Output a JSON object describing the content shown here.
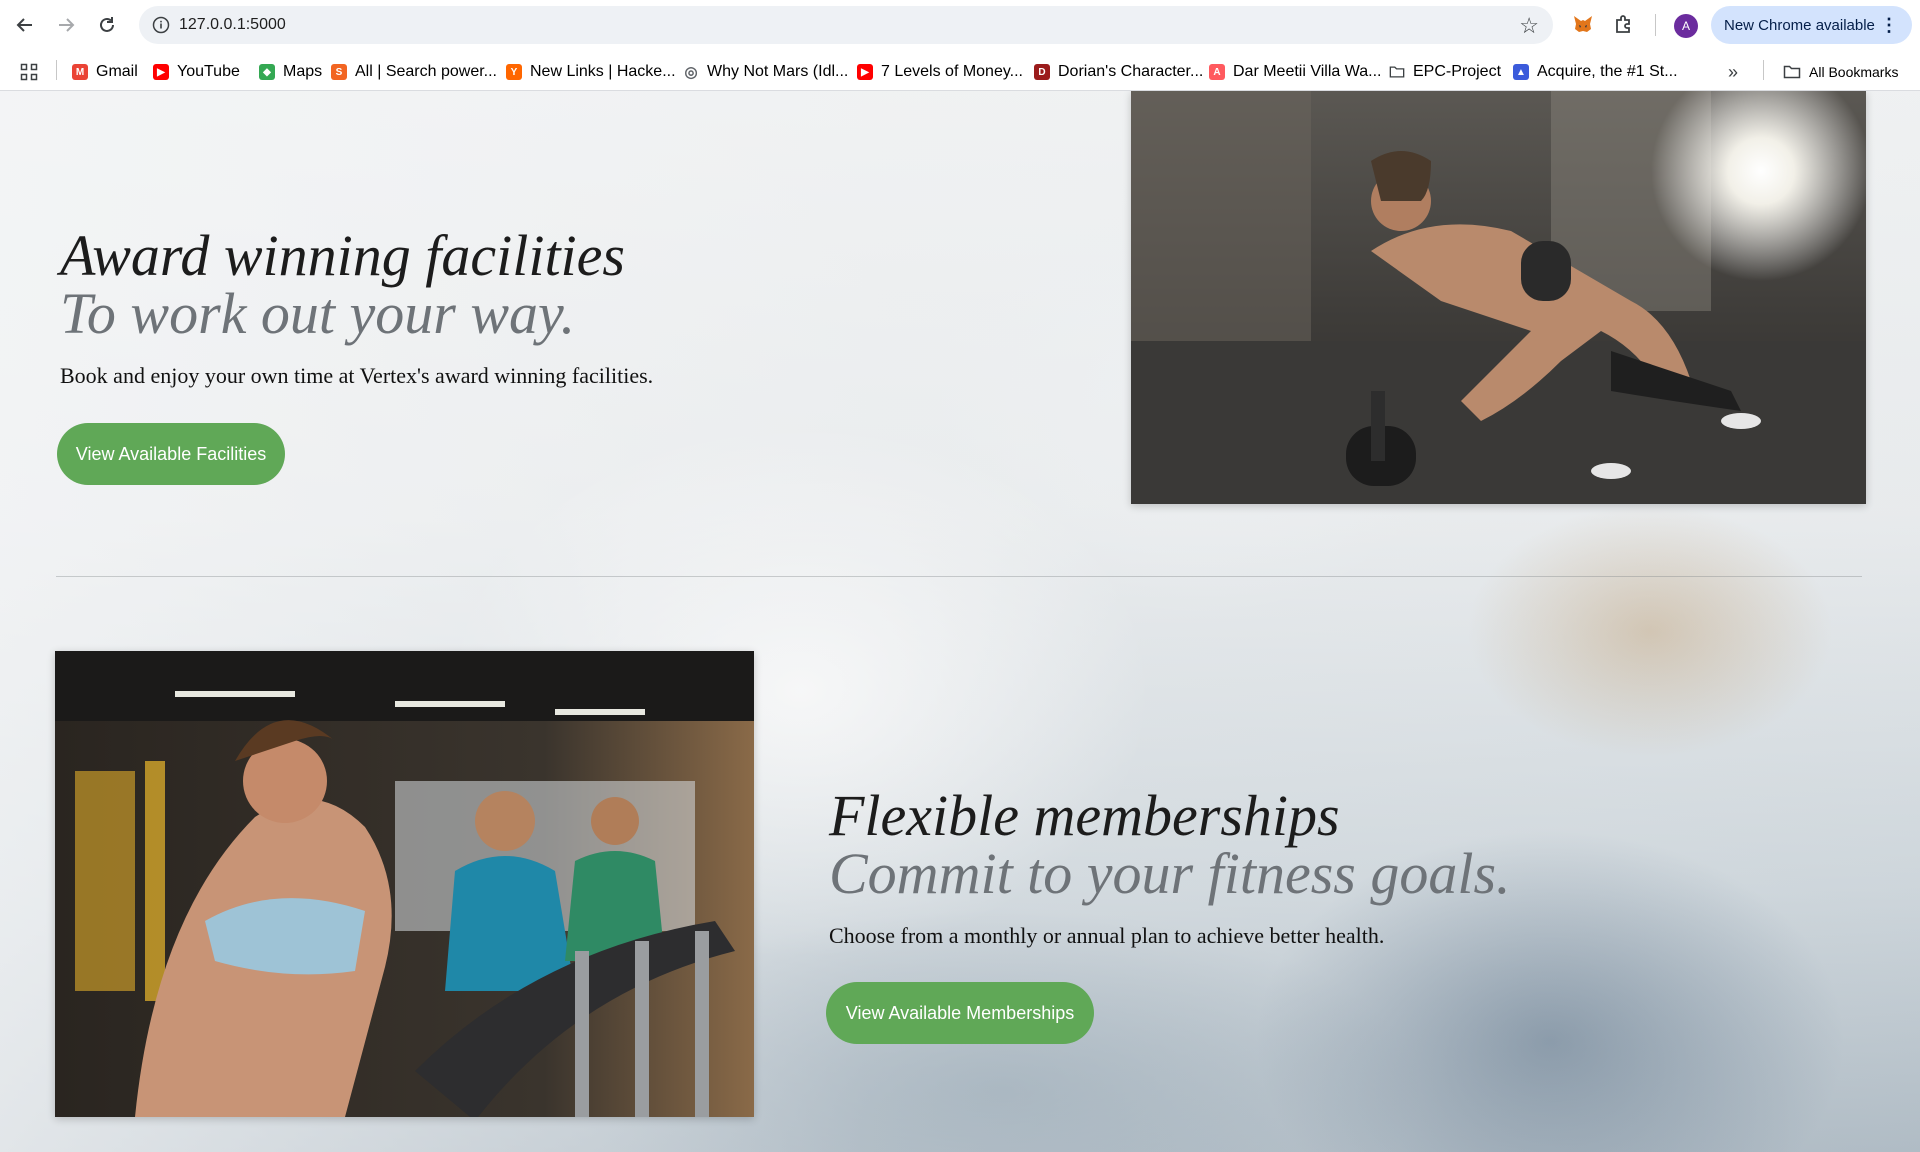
{
  "browser": {
    "url": "127.0.0.1:5000",
    "update_label": "New Chrome available",
    "profile_initial": "A"
  },
  "bookmarks": [
    {
      "label": "Gmail",
      "icon": "gmail-icon",
      "color": "#ea4335"
    },
    {
      "label": "YouTube",
      "icon": "youtube-icon",
      "color": "#ff0000"
    },
    {
      "label": "Maps",
      "icon": "maps-icon",
      "color": "#34a853"
    },
    {
      "label": "All | Search power...",
      "icon": "search-power-icon",
      "color": "#f26522"
    },
    {
      "label": "New Links | Hacke...",
      "icon": "hacker-news-icon",
      "color": "#ff6600"
    },
    {
      "label": "Why Not Mars (Idl...",
      "icon": "globe-icon",
      "color": "#5f6368"
    },
    {
      "label": "7 Levels of Money...",
      "icon": "youtube-icon",
      "color": "#ff0000"
    },
    {
      "label": "Dorian's Character...",
      "icon": "dnd-icon",
      "color": "#9b1c1c"
    },
    {
      "label": "Dar Meetii Villa Wa...",
      "icon": "airbnb-icon",
      "color": "#ff5a5f"
    },
    {
      "label": "EPC-Project",
      "icon": "folder-icon",
      "color": "#5f6368"
    },
    {
      "label": "Acquire, the #1 St...",
      "icon": "acquire-icon",
      "color": "#3b5bdb"
    }
  ],
  "all_bookmarks_label": "All Bookmarks",
  "sections": {
    "facilities": {
      "title": "Award winning facilities",
      "subtitle": "To work out your way.",
      "description": "Book and enjoy your own time at Vertex's award winning facilities.",
      "button": "View Available Facilities"
    },
    "memberships": {
      "title": "Flexible memberships",
      "subtitle": "Commit to your fitness goals.",
      "description": "Choose from a monthly or annual plan to achieve better health.",
      "button": "View Available Memberships"
    }
  },
  "colors": {
    "accent": "#60a857",
    "update_pill": "#d3e3fd"
  }
}
